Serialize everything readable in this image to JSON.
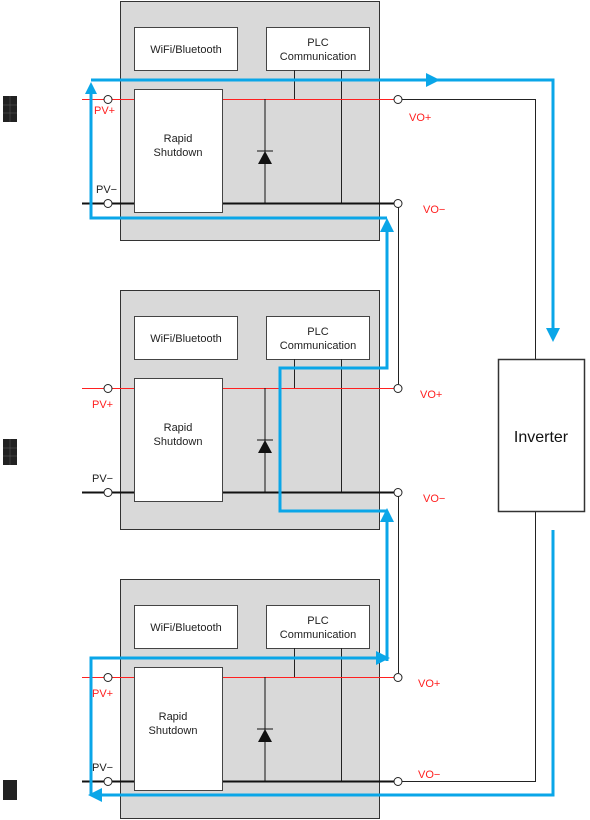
{
  "colors": {
    "flow": "#0aa6e8",
    "positive_line": "#ff2020",
    "module_bg": "#d9d9d9"
  },
  "modules": [
    {
      "wifi": "WiFi/Bluetooth",
      "plc_1": "PLC",
      "plc_2": "Communication",
      "rsd_1": "Rapid",
      "rsd_2": "Shutdown",
      "pv_plus": "PV+",
      "pv_minus": "PV−",
      "vo_plus": "VO+",
      "vo_minus": "VO−"
    },
    {
      "wifi": "WiFi/Bluetooth",
      "plc_1": "PLC",
      "plc_2": "Communication",
      "rsd_1": "Rapid",
      "rsd_2": "Shutdown",
      "pv_plus": "PV+",
      "pv_minus": "PV−",
      "vo_plus": "VO+",
      "vo_minus": "VO−"
    },
    {
      "wifi": "WiFi/Bluetooth",
      "plc_1": "PLC",
      "plc_2": "Communication",
      "rsd_1": "Rapid",
      "rsd_2": "Shutdown",
      "pv_plus": "PV+",
      "pv_minus": "PV−",
      "vo_plus": "VO+",
      "vo_minus": "VO−"
    }
  ],
  "inverter": {
    "label": "Inverter"
  },
  "icons": [
    "solar-panel-icon",
    "solar-panel-icon",
    "solar-panel-icon"
  ]
}
